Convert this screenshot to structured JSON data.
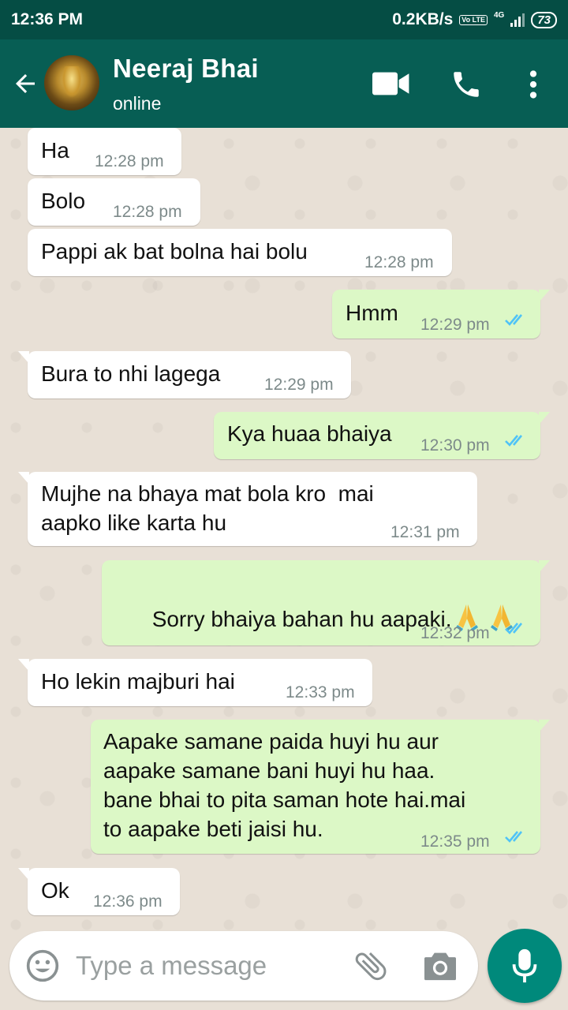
{
  "status_bar": {
    "time": "12:36 PM",
    "network_speed": "0.2KB/s",
    "volte_badge": "Vo LTE",
    "network_type": "4G",
    "battery": "73"
  },
  "header": {
    "contact_name": "Neeraj Bhai",
    "contact_status": "online",
    "icons": [
      "back-arrow-icon",
      "video-call-icon",
      "phone-icon",
      "more-options-icon"
    ]
  },
  "messages": [
    {
      "dir": "in",
      "text": "Ha",
      "time": "12:28 pm"
    },
    {
      "dir": "in",
      "text": "Bolo",
      "time": "12:28 pm"
    },
    {
      "dir": "in",
      "text": "Pappi ak bat bolna hai bolu",
      "time": "12:28 pm"
    },
    {
      "dir": "out",
      "text": "Hmm",
      "time": "12:29 pm",
      "status": "read"
    },
    {
      "dir": "in",
      "text": "Bura to nhi lagega",
      "time": "12:29 pm"
    },
    {
      "dir": "out",
      "text": "Kya huaa bhaiya",
      "time": "12:30 pm",
      "status": "read"
    },
    {
      "dir": "in",
      "text": "Mujhe na bhaya mat bola kro  mai\naapko like karta hu",
      "time": "12:31 pm"
    },
    {
      "dir": "out",
      "text": "Sorry bhaiya bahan hu aapaki.",
      "emoji": "🙏 🙏",
      "time": "12:32 pm",
      "status": "read"
    },
    {
      "dir": "in",
      "text": "Ho lekin majburi hai",
      "time": "12:33 pm"
    },
    {
      "dir": "out",
      "text": "Aapake samane paida huyi hu aur\naapake samane bani huyi hu haa.\nbane bhai to pita saman hote hai.mai\nto aapake beti jaisi hu.",
      "time": "12:35 pm",
      "status": "read"
    },
    {
      "dir": "in",
      "text": "Ok",
      "time": "12:36 pm"
    }
  ],
  "composer": {
    "placeholder": "Type a message",
    "icons": [
      "emoji-icon",
      "attach-icon",
      "camera-icon",
      "mic-icon"
    ]
  },
  "colors": {
    "header": "#075e54",
    "status_bar": "#054d44",
    "incoming_bubble": "#ffffff",
    "outgoing_bubble": "#dcf8c6",
    "read_ticks": "#4fc3f7",
    "mic_button": "#00897b"
  }
}
